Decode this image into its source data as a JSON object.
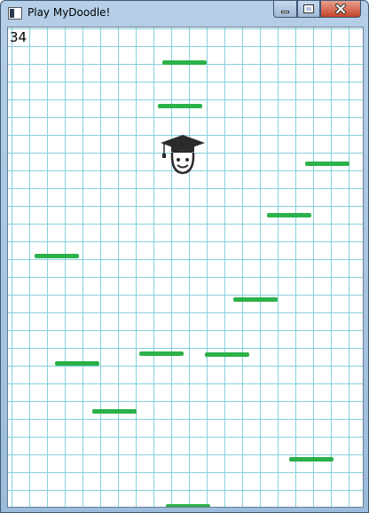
{
  "window": {
    "title": "Play MyDoodle!",
    "minimize_icon": "minimize-icon",
    "maximize_icon": "maximize-icon",
    "close_icon": "close-icon"
  },
  "game": {
    "score": "34",
    "grid_color": "#86d0dc",
    "platform_color": "#2bb14a",
    "player_icon": "graduate-doodler-icon",
    "platform_count": 13
  }
}
